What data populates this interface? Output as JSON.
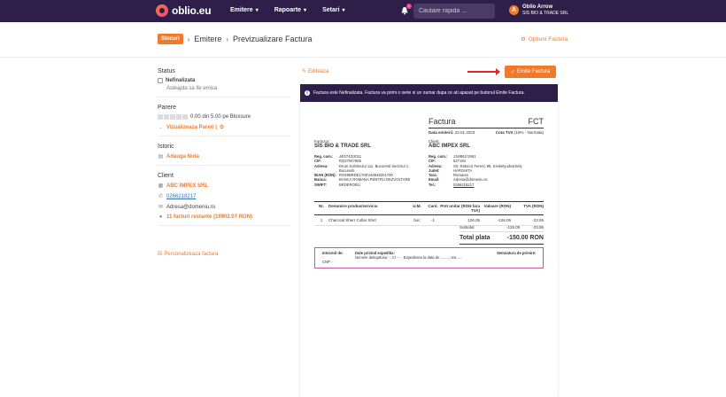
{
  "navbar": {
    "logo_text": "oblio.eu",
    "menu": [
      {
        "label": "Emitere"
      },
      {
        "label": "Rapoarte"
      },
      {
        "label": "Setari"
      }
    ],
    "notifications_count": "1",
    "search_placeholder": "Cautare rapida ...",
    "user_initial": "A",
    "user_name": "Oblio Arrow",
    "user_company": "SIS BIO & TRADE SRL"
  },
  "breadcrumb": {
    "tag": "Stocuri",
    "items": [
      "Emitere",
      "Previzualizare Factura"
    ],
    "options_label": "Optiuni Factura"
  },
  "sidebar": {
    "status_title": "Status",
    "status_value": "Nefinalizata",
    "status_note": "Asteapta sa fie emisa",
    "rating_title": "Parere",
    "rating_text": "0.00 din 5.00 pe Bloxsure",
    "rating_link": "Vizualizeaza Pareri |",
    "history_title": "Istoric",
    "history_link": "Adauga Nota",
    "client_title": "Client",
    "client_name": "ABC IMPEX SRL",
    "client_phone": "0266218217",
    "client_email": "Adresa@domeniu.ro",
    "client_outstanding": "11 facturi restante (19902.07 RON)",
    "personalize_link": "Personalizeaza factura"
  },
  "actions": {
    "edit_label": "Editeaza",
    "emit_label": "Emite Factura"
  },
  "alert": {
    "text": "Factura este Nefinalizata. Factura va primi o serie si un numar dupa ce ati apasat pe butonul Emite Factura."
  },
  "invoice": {
    "title": "Factura",
    "series": "FCT",
    "date_label": "Data emiterii:",
    "date": "23.01.2023",
    "vat_label": "Cota TVA",
    "vat_value": "(19% - Normala)",
    "supplier": {
      "label": "Furnizor:",
      "name": "SIS BIO & TRADE SRL",
      "fields": [
        [
          "Reg. com.:",
          "J40/742/2011"
        ],
        [
          "CIF:",
          "RO27947665"
        ],
        [
          "Adresa:",
          "Drum Sofolinului 111, Bucuresti Sectorul 1, Bucuresti"
        ],
        [
          "IBAN (RON):",
          "RO49BRDE170SV40846201700"
        ],
        [
          "Banca:",
          "BANCA ROMANA PENTRU DEZVOLTARE"
        ],
        [
          "SWIFT:",
          "BRDEROBU"
        ]
      ]
    },
    "client": {
      "label": "Client:",
      "name": "ABC IMPEX SRL",
      "fields": [
        [
          "Reg. com.:",
          "J19/861/1991"
        ],
        [
          "CIF:",
          "527184"
        ],
        [
          "Adresa:",
          "Str. Rakoczi Ferenc 98, Szekelyudvarhely"
        ],
        [
          "Judet:",
          "HARGHITA"
        ],
        [
          "Tara:",
          "Romania"
        ],
        [
          "Email:",
          "Adresa@domeniu.ro"
        ],
        [
          "Tel.:",
          "0266218217"
        ]
      ]
    },
    "columns": [
      "Nr.",
      "Denumire produs/serviciu",
      "U.M.",
      "Cant.",
      "Pret unitar (RON fara TVA)",
      "Valoare (RON)",
      "TVA (RON)"
    ],
    "rows": [
      [
        "1",
        "Charcoal Sherr Collar Shirt",
        "buc",
        "-1",
        "126.05",
        "-126.05",
        "-23.95"
      ]
    ],
    "subtotal_label": "Subtotal",
    "subtotal_value": "-126.05",
    "subtotal_vat": "-23.95",
    "total_label": "Total plata",
    "total_value": "-150.00 RON",
    "footer": {
      "issuer_label": "Intocmit de:",
      "issuer_value": "-",
      "cnp_label": "CNP: -",
      "shipping_label": "Date privind expeditia:",
      "shipping_text": "Numele delegatului: -, CI - - , Expedierea la data de ........, ora .....",
      "signature_label": "Semnatura de primire:"
    }
  },
  "colors": {
    "navbar": "#2e1f4a",
    "accent": "#f07a2a",
    "arrow": "#e02626"
  }
}
